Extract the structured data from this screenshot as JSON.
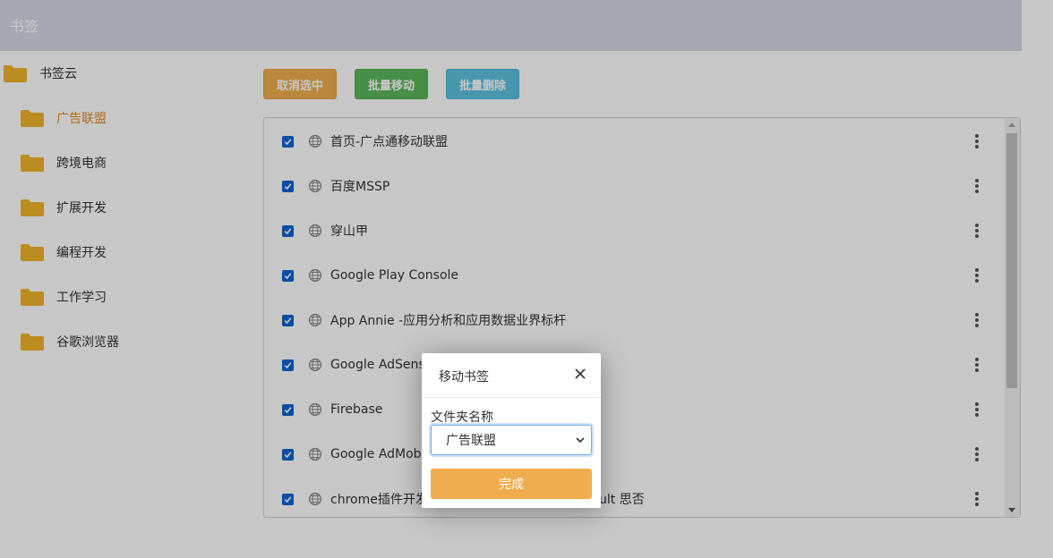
{
  "header": {
    "title": "书签"
  },
  "sidebar": {
    "root": {
      "label": "书签云"
    },
    "items": [
      {
        "label": "广告联盟",
        "active": true
      },
      {
        "label": "跨境电商",
        "active": false
      },
      {
        "label": "扩展开发",
        "active": false
      },
      {
        "label": "编程开发",
        "active": false
      },
      {
        "label": "工作学习",
        "active": false
      },
      {
        "label": "谷歌浏览器",
        "active": false
      }
    ]
  },
  "toolbar": {
    "deselect_label": "取消选中",
    "batch_move_label": "批量移动",
    "batch_delete_label": "批量删除"
  },
  "bookmarks": [
    {
      "title": "首页-广点通移动联盟",
      "checked": true
    },
    {
      "title": "百度MSSP",
      "checked": true
    },
    {
      "title": "穿山甲",
      "checked": true
    },
    {
      "title": "Google Play Console",
      "checked": true
    },
    {
      "title": "App Annie -应用分析和应用数据业界标杆",
      "checked": true
    },
    {
      "title": "Google AdSense",
      "checked": true
    },
    {
      "title": "Firebase",
      "checked": true
    },
    {
      "title": "Google AdMob",
      "checked": true
    },
    {
      "title": "chrome插件开发",
      "title_visible_tail": "ult 思否",
      "checked": true
    }
  ],
  "modal": {
    "title": "移动书签",
    "field_label": "文件夹名称",
    "selected_folder": "广告联盟",
    "done_label": "完成"
  },
  "colors": {
    "header_bg": "#d4d8e4",
    "folder": "#f0b429",
    "active_text": "#e08a1e",
    "warn": "#f0ad4e",
    "success": "#5cb85c",
    "info": "#5bc0de",
    "checkbox": "#0b63ce"
  }
}
